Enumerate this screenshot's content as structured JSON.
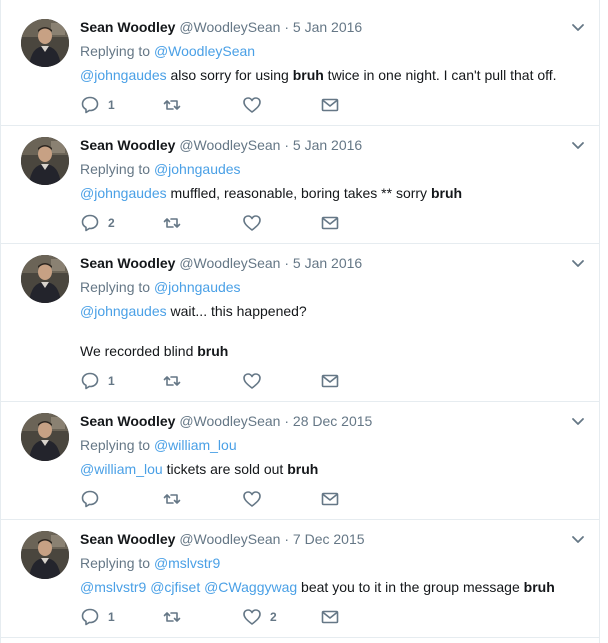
{
  "colors": {
    "link": "#4aa0e6",
    "secondary_text": "#657786",
    "primary_text": "#14171a",
    "divider": "#e6ecf0"
  },
  "icons": {
    "reply": "reply-icon",
    "retweet": "retweet-icon",
    "like": "heart-icon",
    "dm": "envelope-icon",
    "caret": "chevron-down-icon"
  },
  "tweets": [
    {
      "fullname": "Sean Woodley",
      "username": "@WoodleySean",
      "dot": "·",
      "time": "5 Jan 2016",
      "replying_prefix": "Replying to",
      "replying_to": "@WoodleySean",
      "mentions": "@johngaudes",
      "text_before": " also sorry for using ",
      "bold": "bruh",
      "text_after": " twice in one night. I can't pull that off.",
      "reply_count": "1",
      "retweet_count": "",
      "like_count": ""
    },
    {
      "fullname": "Sean Woodley",
      "username": "@WoodleySean",
      "dot": "·",
      "time": "5 Jan 2016",
      "replying_prefix": "Replying to",
      "replying_to": "@johngaudes",
      "mentions": "@johngaudes",
      "text_before": " muffled, reasonable, boring takes ** sorry ",
      "bold": "bruh",
      "text_after": "",
      "reply_count": "2",
      "retweet_count": "",
      "like_count": ""
    },
    {
      "fullname": "Sean Woodley",
      "username": "@WoodleySean",
      "dot": "·",
      "time": "5 Jan 2016",
      "replying_prefix": "Replying to",
      "replying_to": "@johngaudes",
      "mentions": "@johngaudes",
      "text_before": " wait... this happened?",
      "para2_before": "We recorded blind ",
      "bold": "bruh",
      "text_after": "",
      "reply_count": "1",
      "retweet_count": "",
      "like_count": ""
    },
    {
      "fullname": "Sean Woodley",
      "username": "@WoodleySean",
      "dot": "·",
      "time": "28 Dec 2015",
      "replying_prefix": "Replying to",
      "replying_to": "@william_lou",
      "mentions": "@william_lou",
      "text_before": " tickets are sold out ",
      "bold": "bruh",
      "text_after": "",
      "reply_count": "",
      "retweet_count": "",
      "like_count": ""
    },
    {
      "fullname": "Sean Woodley",
      "username": "@WoodleySean",
      "dot": "·",
      "time": "7 Dec 2015",
      "replying_prefix": "Replying to",
      "replying_to": "@mslvstr9",
      "mentions": "@mslvstr9 @cjfiset @CWaggywag",
      "text_before": " beat you to it in the group message ",
      "bold": "bruh",
      "text_after": "",
      "reply_count": "1",
      "retweet_count": "",
      "like_count": "2"
    }
  ]
}
